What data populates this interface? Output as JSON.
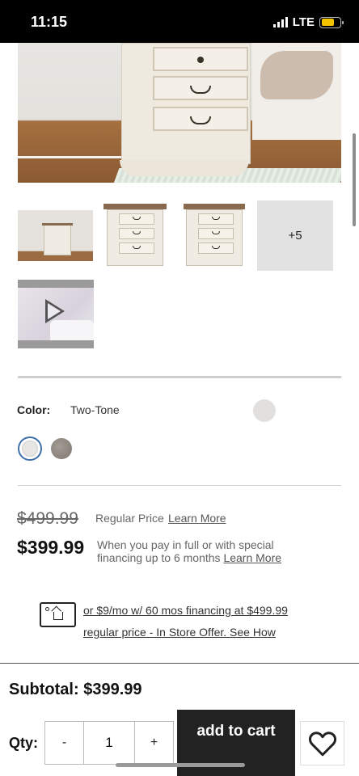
{
  "status_bar": {
    "time": "11:15",
    "network": "LTE",
    "battery_color": "#f4c300"
  },
  "gallery": {
    "more_label": "+5",
    "icons": {
      "play": "play-icon"
    }
  },
  "color": {
    "label": "Color:",
    "value": "Two-Tone",
    "swatches": [
      {
        "name": "Two-Tone",
        "color": "#e8e6e3",
        "selected": true
      },
      {
        "name": "Gray",
        "color": "#8f8a82",
        "selected": false
      }
    ]
  },
  "pricing": {
    "old_price": "$499.99",
    "regular_price_label": "Regular Price",
    "learn_more_1": "Learn More",
    "new_price": "$399.99",
    "financing_note": "When you pay in full or with special financing up to 6 months",
    "learn_more_2": "Learn More"
  },
  "financing_offer": {
    "icon": "financing-card-icon",
    "line1": "or $9/mo w/ 60 mos financing at $499.99",
    "line2": "regular price - In Store Offer. See How"
  },
  "cart": {
    "subtotal": "Subtotal: $399.99",
    "qty_label": "Qty:",
    "decrement": "-",
    "quantity": "1",
    "increment": "+",
    "add_to_cart": "add to cart",
    "wishlist_icon": "heart-icon"
  }
}
